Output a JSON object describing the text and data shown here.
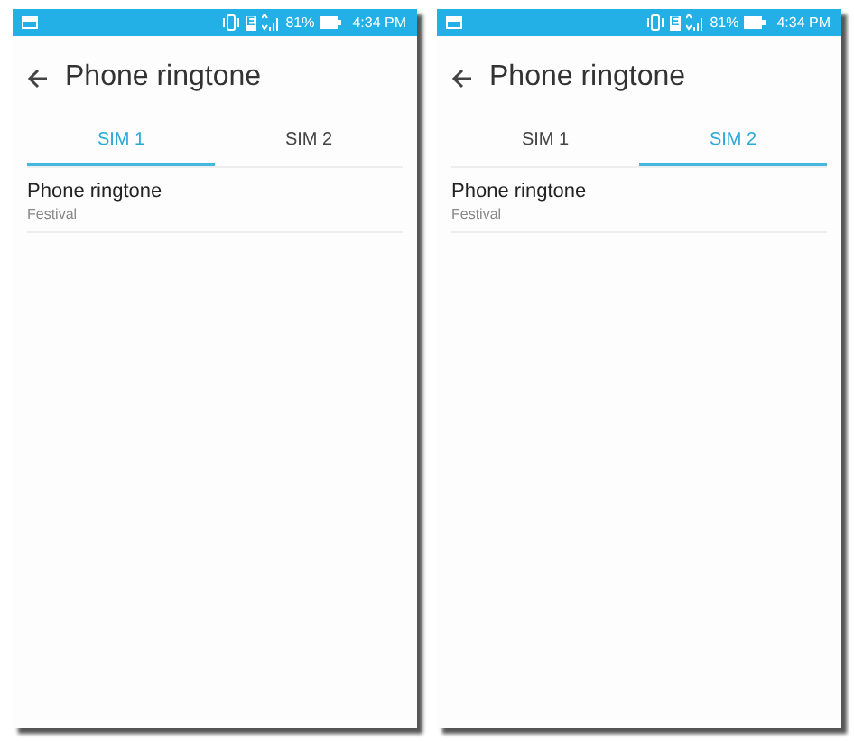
{
  "screens": [
    {
      "status_bar": {
        "carrier": "E",
        "battery": "81%",
        "time": "4:34 PM"
      },
      "title": "Phone ringtone",
      "tabs": [
        {
          "label": "SIM 1",
          "selected": true
        },
        {
          "label": "SIM 2",
          "selected": false
        }
      ],
      "items": [
        {
          "title": "Phone ringtone",
          "value": "Festival"
        }
      ]
    },
    {
      "status_bar": {
        "carrier": "E",
        "battery": "81%",
        "time": "4:34 PM"
      },
      "title": "Phone ringtone",
      "tabs": [
        {
          "label": "SIM 1",
          "selected": false
        },
        {
          "label": "SIM 2",
          "selected": true
        }
      ],
      "items": [
        {
          "title": "Phone ringtone",
          "value": "Festival"
        }
      ]
    }
  ]
}
